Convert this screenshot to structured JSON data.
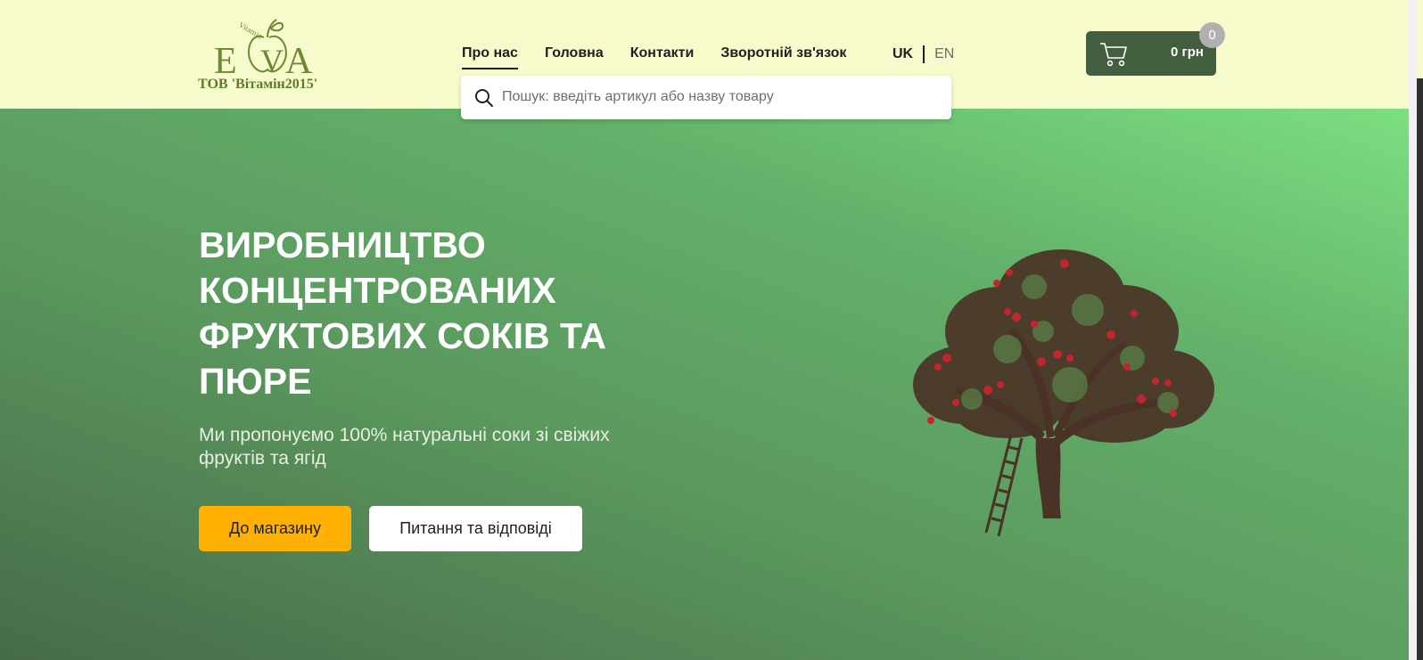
{
  "header": {
    "logo": {
      "caption": "ТОВ 'Вітамін2015'"
    },
    "nav": [
      {
        "label": "Про нас",
        "active": true
      },
      {
        "label": "Головна"
      },
      {
        "label": "Контакти"
      },
      {
        "label": "Зворотній зв'язок"
      }
    ],
    "languages": {
      "uk": "UK",
      "en": "EN"
    },
    "search": {
      "placeholder": "Пошук: введіть артикул або назву товару",
      "value": ""
    },
    "cart": {
      "total": "0 грн",
      "count": "0"
    }
  },
  "hero": {
    "title": "ВИРОБНИЦТВО КОНЦЕНТРОВАНИХ ФРУКТОВИХ СОКІВ ТА ПЮРЕ",
    "subtitle": "Ми пропонуємо 100% натуральні соки зі свіжих фруктів та ягід",
    "buttons": {
      "shop": "До магазину",
      "faq": "Питання та відповіді"
    }
  },
  "colors": {
    "header_bg": "#f7fbcc",
    "cart_bg": "#435e3e",
    "primary_button": "#ffb000",
    "hero_gradient_light": "#7bdf80",
    "hero_gradient_dark": "#476b49"
  },
  "icons": [
    "eva-logo",
    "search-icon",
    "cart-icon",
    "apple-tree-illustration"
  ]
}
